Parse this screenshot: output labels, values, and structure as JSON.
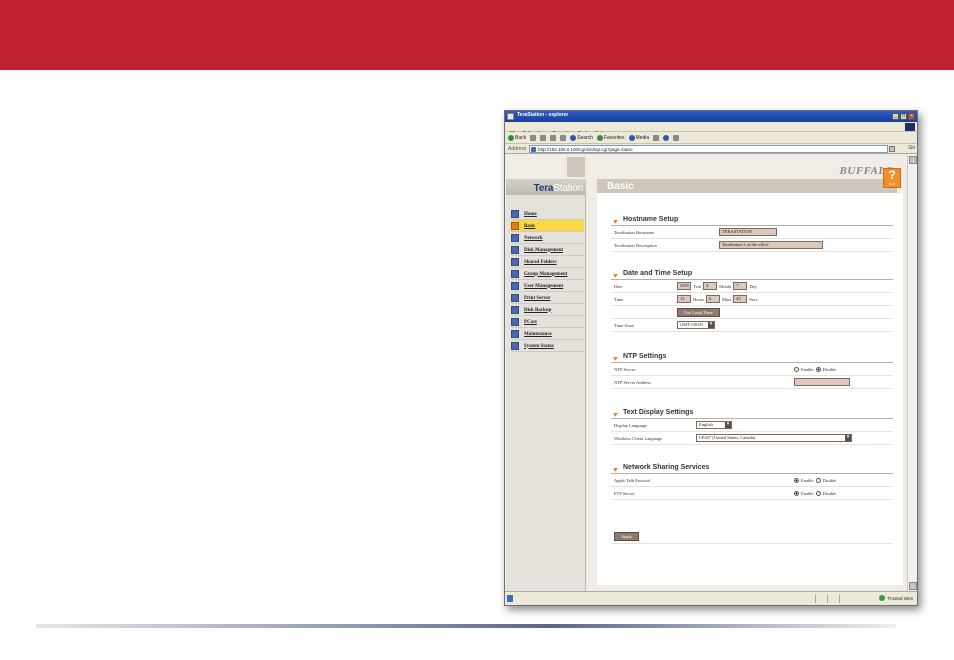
{
  "browser": {
    "title": "TeraStation - explorer",
    "menu": [
      "File",
      "Edit",
      "View",
      "Favorites",
      "Tools",
      "Help"
    ],
    "toolbar": {
      "back": "Back",
      "search": "Search",
      "favorites": "Favorites",
      "media": "Media"
    },
    "address_label": "Address",
    "url": "http://192.168.0.100/cgi-bin/top.cgi?page=basic",
    "go": "Go",
    "status_zone": "Trusted sites"
  },
  "app": {
    "logo_bold": "Tera",
    "logo_rest": "Station",
    "brand": "BUFFALO",
    "page_title": "Basic",
    "help_label": "Help"
  },
  "nav": [
    {
      "label": "Home"
    },
    {
      "label": "Basic",
      "active": true
    },
    {
      "label": "Network"
    },
    {
      "label": "Disk Management"
    },
    {
      "label": "Shared Folders"
    },
    {
      "label": "Group Management"
    },
    {
      "label": "User Management"
    },
    {
      "label": "Print Server"
    },
    {
      "label": "Disk Backup"
    },
    {
      "label": "PCast"
    },
    {
      "label": "Maintenance"
    },
    {
      "label": "System Status"
    }
  ],
  "hostname": {
    "title": "Hostname Setup",
    "hostname_label": "TeraStation Hostname",
    "hostname_value": "TERASTATION",
    "desc_label": "TeraStation Description",
    "desc_value": "TeraStation 1 at the office"
  },
  "datetime": {
    "title": "Date and Time Setup",
    "date_label": "Date",
    "year_value": "2005",
    "year_unit": "Year",
    "month_value": "4",
    "month_unit": "Month",
    "day_value": "7",
    "day_unit": "Day",
    "time_label": "Time",
    "hours_value": "13",
    "hours_unit": "Hours",
    "mins_value": "6",
    "mins_unit": "Mins",
    "secs_value": "45",
    "secs_unit": "Secs",
    "local_time_button": "Use Local Time",
    "tz_label": "Time Zone",
    "tz_value": "GMT+09:00"
  },
  "ntp": {
    "title": "NTP Settings",
    "server_label": "NTP Server",
    "enable": "Enable",
    "disable": "Disable",
    "selected": "disable",
    "address_label": "NTP Server Address",
    "address_value": ""
  },
  "textdisplay": {
    "title": "Text Display Settings",
    "lang_label": "Display Language",
    "lang_value": "English",
    "client_label": "Windows Client Language",
    "client_value": "CP437 (United States, Canada)"
  },
  "sharing": {
    "title": "Network Sharing Services",
    "afp_label": "Apple Talk Protocol",
    "ftp_label": "FTP Server",
    "enable": "Enable",
    "disable": "Disable",
    "afp_selected": "enable",
    "ftp_selected": "enable"
  },
  "apply_label": "Apply",
  "colors": {
    "banner": "#c1212f",
    "active_nav": "#f6d944",
    "accent": "#e8761d",
    "help": "#f0902a"
  }
}
